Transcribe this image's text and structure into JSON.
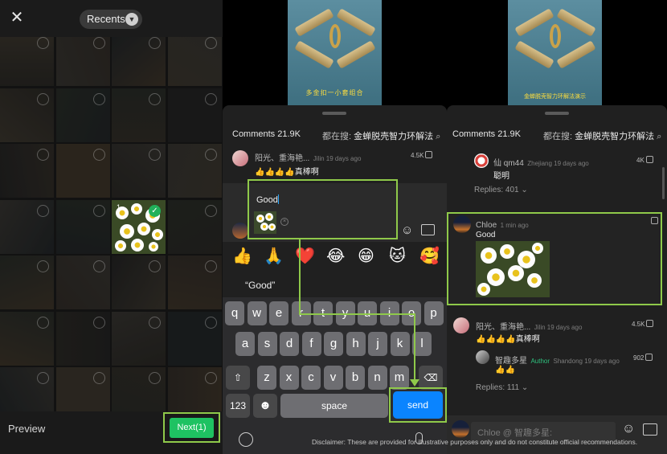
{
  "gallery": {
    "album_label": "Recents",
    "selected_index": "1",
    "preview_label": "Preview",
    "next_label": "Next(1)"
  },
  "video": {
    "caption_left": "多金扣一小套组合",
    "caption_right": "金蝉脱壳智力环解法演示"
  },
  "comments_panel_left": {
    "count_label": "Comments 21.9K",
    "search_prefix": "都在搜:",
    "search_term": "金蝉脱壳智力环解法",
    "top_comment": {
      "user": "阳光、重海艳...",
      "meta": "Jilin 19 days ago",
      "likes": "4.5K",
      "text": "👍👍👍👍真棒啊"
    },
    "draft_text": "Good",
    "emoji_row": [
      "👍",
      "🙏",
      "❤️",
      "😂",
      "😁",
      "🐱",
      "🥰"
    ],
    "suggestion": "“Good”",
    "keys": {
      "row1": [
        "q",
        "w",
        "e",
        "r",
        "t",
        "y",
        "u",
        "i",
        "o",
        "p"
      ],
      "row2": [
        "a",
        "s",
        "d",
        "f",
        "g",
        "h",
        "j",
        "k",
        "l"
      ],
      "row3": [
        "z",
        "x",
        "c",
        "v",
        "b",
        "n",
        "m"
      ],
      "shift": "⇧",
      "backspace": "⌫",
      "num_label": "123",
      "emoji_key": "☻",
      "space_label": "space",
      "send_label": "send"
    }
  },
  "comments_panel_right": {
    "count_label": "Comments 21.9K",
    "search_prefix": "都在搜:",
    "search_term": "金蝉脱壳智力环解法",
    "reply_comment": {
      "user": "仙 qm44",
      "meta": "Zhejiang 19 days ago",
      "likes": "4K",
      "text": "聪明",
      "replies": "Replies: 401"
    },
    "new_comment": {
      "user": "Chloe",
      "meta": "1 min ago",
      "text": "Good"
    },
    "top_comment": {
      "user": "阳光、重海艳...",
      "meta": "Jilin 19 days ago",
      "likes": "4.5K",
      "text": "👍👍👍👍真棒啊"
    },
    "author_reply": {
      "user": "智趣多星",
      "badge": "Author",
      "meta": "Shandong 19 days ago",
      "likes": "902",
      "text": "👍👍",
      "replies": "Replies: 111"
    },
    "input_placeholder": "Chloe @ 智趣多星:"
  },
  "disclaimer": "Disclaimer: These are provided for illustrative purposes only and do not constitute official recommendations.",
  "colors": {
    "highlight": "#8fc94a",
    "next_button": "#1ec262",
    "send_button": "#0a84ff",
    "author_badge": "#2ec27e"
  }
}
